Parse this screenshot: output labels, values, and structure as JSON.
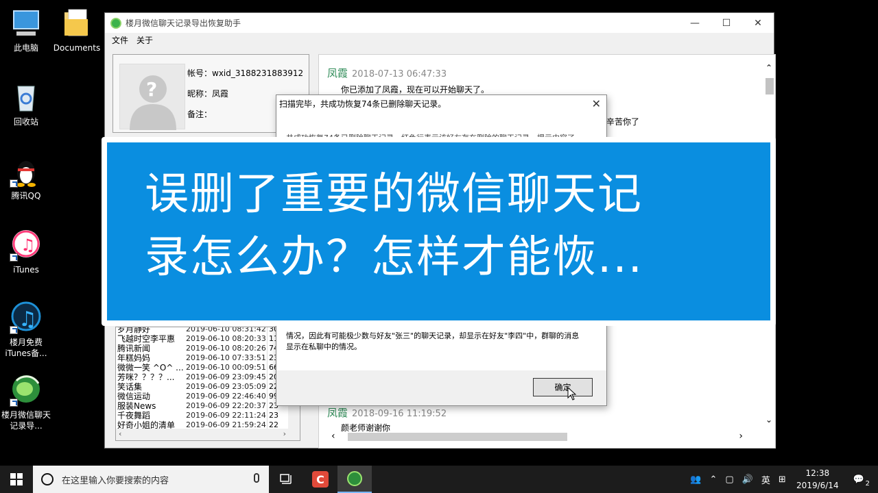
{
  "desktop": {
    "icons": [
      {
        "label": "此电脑"
      },
      {
        "label": "Documents"
      },
      {
        "label": "回收站"
      },
      {
        "label": "腾讯QQ"
      },
      {
        "label": "iTunes"
      },
      {
        "label": "楼月免费iTunes备..."
      },
      {
        "label": "楼月微信聊天记录导..."
      }
    ]
  },
  "app": {
    "title": "楼月微信聊天记录导出恢复助手",
    "menu": [
      "文件",
      "关于"
    ],
    "window_controls": {
      "minimize": "—",
      "maximize": "☐",
      "close": "✕"
    },
    "profile": {
      "account": "帐号：wxid_3188231883912",
      "nickname": "昵称：凤霞",
      "remark": "备注："
    },
    "contacts": [
      {
        "name": "岁月静好",
        "time": "2019-06-10 08:31:42",
        "count": "30"
      },
      {
        "name": "飞越时空李平惠",
        "time": "2019-06-10 08:20:33",
        "count": "11"
      },
      {
        "name": "腾讯新闻",
        "time": "2019-06-10 08:20:26",
        "count": "74"
      },
      {
        "name": "年糕妈妈",
        "time": "2019-06-10 07:33:51",
        "count": "23"
      },
      {
        "name": "微微一笑 ^O^ ...",
        "time": "2019-06-10 00:09:51",
        "count": "66"
      },
      {
        "name": "芳咪？？？？...",
        "time": "2019-06-09 23:09:45",
        "count": "20"
      },
      {
        "name": "笑话集",
        "time": "2019-06-09 23:05:09",
        "count": "22"
      },
      {
        "name": "微信运动",
        "time": "2019-06-09 22:46:40",
        "count": "99"
      },
      {
        "name": "服装News",
        "time": "2019-06-09 22:20:37",
        "count": "23"
      },
      {
        "name": "千夜舞蹈",
        "time": "2019-06-09 22:11:24",
        "count": "23"
      },
      {
        "name": "好奇小姐的清单",
        "time": "2019-06-09 21:59:24",
        "count": "22"
      }
    ],
    "chat": {
      "messages": [
        {
          "sender": "凤霞",
          "time": "2018-07-13 06:47:33",
          "text": "你已添加了凤霞，现在可以开始聊天了。"
        },
        {
          "sender": "",
          "time": "",
          "text": "辛苦你了"
        },
        {
          "sender": "凤霞",
          "time": "2018-09-16 11:19:52",
          "text": "颜老师谢谢你"
        }
      ]
    }
  },
  "dialog": {
    "title": "扫描完毕，共成功恢复74条已删除聊天记录。",
    "body_top": "共成功恢复74条已删除聊天记录，红色行表示该好友存在删除的聊天记录，提示内容了。",
    "body_line1": "情况，因此有可能极少数与好友\"张三\"的聊天记录，却显示在好友\"李四\"中，群聊的消息",
    "body_line2": "显示在私聊中的情况。",
    "ok_label": "确定"
  },
  "banner": {
    "line1": "误删了重要的微信聊天记",
    "line2": "录怎么办？怎样才能恢..."
  },
  "taskbar": {
    "search_placeholder": "在这里输入你要搜索的内容",
    "ime": "英",
    "time": "12:38",
    "date": "2019/6/14",
    "notifications": "2"
  }
}
